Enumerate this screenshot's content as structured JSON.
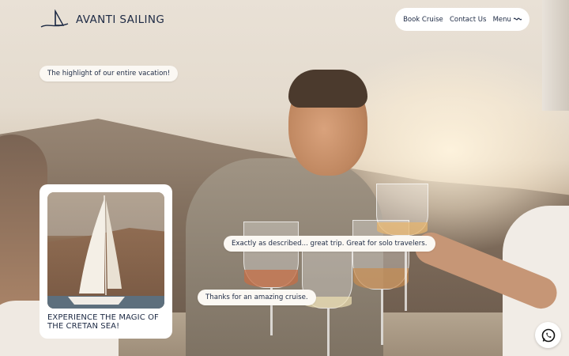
{
  "brand": {
    "name": "AVANTI SAILING",
    "logo_icon": "sail-logo-icon"
  },
  "nav": {
    "book_cruise": "Book Cruise",
    "contact_us": "Contact Us",
    "menu": "Menu",
    "menu_icon": "wave-icon"
  },
  "reviews": [
    "The highlight of our entire vacation!",
    "Exactly as described... great trip. Great for solo travelers.",
    "Thanks for an amazing cruise."
  ],
  "promo_card": {
    "title_line1": "EXPERIENCE THE MAGIC OF",
    "title_line2": "THE CRETAN SEA!",
    "image": "sailboat-photo"
  },
  "floating": {
    "chat_icon": "whatsapp-icon"
  },
  "colors": {
    "text": "#1d2a44",
    "pill_bg": "#fbf8f3",
    "card_bg": "#ffffff"
  }
}
